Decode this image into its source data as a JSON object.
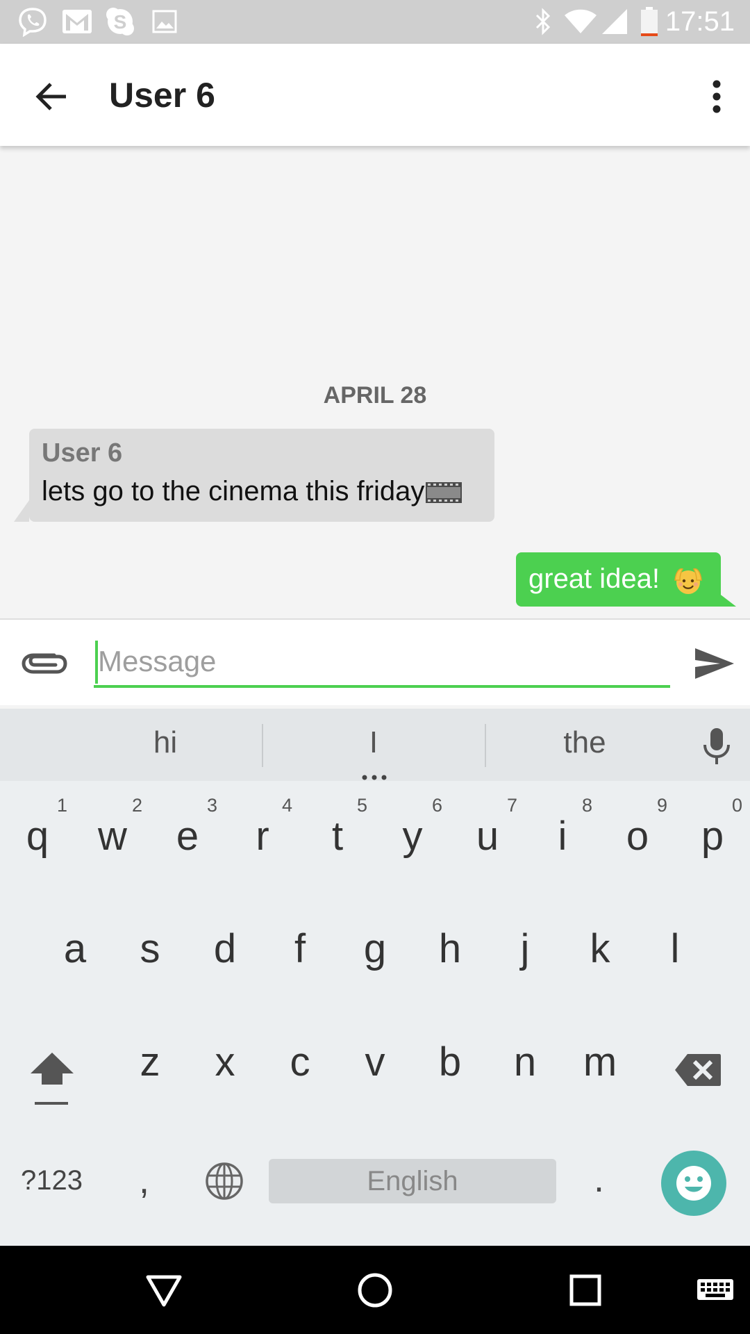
{
  "status_bar": {
    "time": "17:51",
    "left_icons": [
      "viber-icon",
      "gmail-icon",
      "skype-icon",
      "image-icon"
    ],
    "right_icons": [
      "bluetooth-icon",
      "wifi-icon",
      "signal-icon",
      "battery-low-icon"
    ]
  },
  "app_bar": {
    "title": "User 6",
    "back_icon": "arrow-back-icon",
    "menu_icon": "more-vertical-icon"
  },
  "chat": {
    "date_separator": "APRIL 28",
    "messages": [
      {
        "direction": "incoming",
        "sender": "User 6",
        "text": "lets go to the cinema this friday",
        "emoji": "film-strip-icon"
      },
      {
        "direction": "outgoing",
        "text": "great idea! ",
        "emoji": "smiling-face-emoji"
      }
    ]
  },
  "composer": {
    "placeholder": "Message",
    "attach_icon": "paperclip-icon",
    "send_icon": "send-icon"
  },
  "keyboard": {
    "suggestions": [
      "hi",
      "I",
      "the"
    ],
    "row1": [
      {
        "key": "q",
        "num": "1"
      },
      {
        "key": "w",
        "num": "2"
      },
      {
        "key": "e",
        "num": "3"
      },
      {
        "key": "r",
        "num": "4"
      },
      {
        "key": "t",
        "num": "5"
      },
      {
        "key": "y",
        "num": "6"
      },
      {
        "key": "u",
        "num": "7"
      },
      {
        "key": "i",
        "num": "8"
      },
      {
        "key": "o",
        "num": "9"
      },
      {
        "key": "p",
        "num": "0"
      }
    ],
    "row2": [
      "a",
      "s",
      "d",
      "f",
      "g",
      "h",
      "j",
      "k",
      "l"
    ],
    "row3": [
      "z",
      "x",
      "c",
      "v",
      "b",
      "n",
      "m"
    ],
    "symbols_label": "?123",
    "comma": ",",
    "period": ".",
    "space_label": "English"
  },
  "colors": {
    "accent": "#4cd050",
    "incoming_bubble": "#dcdcdc",
    "emoji_key": "#4db6ac"
  }
}
